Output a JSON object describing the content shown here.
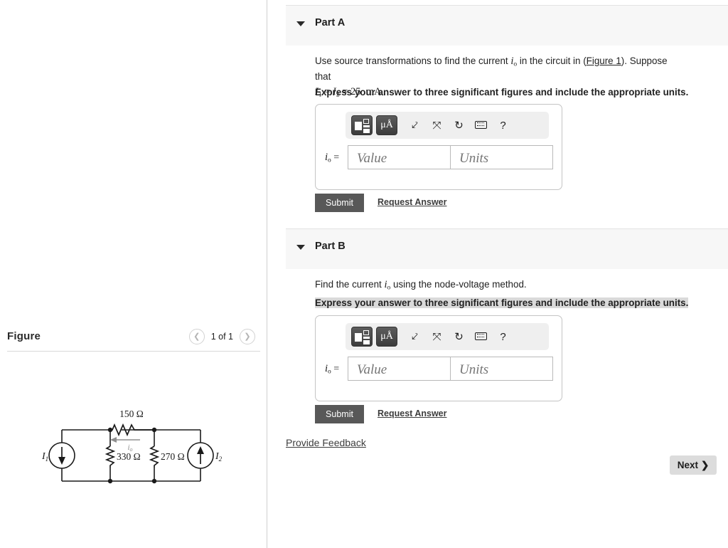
{
  "figure_panel": {
    "title": "Figure",
    "pager": {
      "prev_icon": "chevron-left-icon",
      "next_icon": "chevron-right-icon",
      "count_label": "1 of 1"
    },
    "circuit": {
      "source_left_label": "I",
      "source_left_sub": "1",
      "source_left_direction": "down",
      "source_right_label": "I",
      "source_right_sub": "2",
      "source_right_direction": "up",
      "top_resistor": "150 Ω",
      "left_resistor": "330 Ω",
      "right_resistor": "270 Ω",
      "current_label": "i",
      "current_sub": "o",
      "current_direction": "left"
    }
  },
  "parts": [
    {
      "id": "part-a",
      "caret_icon": "caret-down-icon",
      "title": "Part A",
      "prompt_pre": "Use source transformations to find the current ",
      "prompt_sym": "i",
      "prompt_sym_sub": "o",
      "prompt_mid": " in the circuit in (",
      "prompt_link": "Figure 1",
      "prompt_post": "). Suppose that",
      "prompt_line2": "I₁ = I₂ = 25 mA .",
      "instruction": "Express your answer to three significant figures and include the appropriate units.",
      "instruction_highlighted": false,
      "answer": {
        "label_sym": "i",
        "label_sub": "o",
        "label_eq": " = ",
        "value_placeholder": "Value",
        "value": "",
        "units_placeholder": "Units",
        "units": "",
        "toolbar": [
          {
            "name": "math-template-button",
            "label": ""
          },
          {
            "name": "units-button",
            "label": "μÅ"
          },
          {
            "name": "undo-icon",
            "label": "⮤"
          },
          {
            "name": "redo-icon",
            "label": "⮥"
          },
          {
            "name": "reset-icon",
            "label": "↺"
          },
          {
            "name": "keyboard-icon",
            "label": ""
          },
          {
            "name": "help-icon",
            "label": "?"
          }
        ]
      },
      "submit_label": "Submit",
      "request_answer_label": "Request Answer"
    },
    {
      "id": "part-b",
      "caret_icon": "caret-down-icon",
      "title": "Part B",
      "prompt_pre": "Find the current ",
      "prompt_sym": "i",
      "prompt_sym_sub": "o",
      "prompt_mid": " using the node-voltage method.",
      "prompt_link": "",
      "prompt_post": "",
      "prompt_line2": "",
      "instruction": "Express your answer to three significant figures and include the appropriate units.",
      "instruction_highlighted": true,
      "answer": {
        "label_sym": "i",
        "label_sub": "o",
        "label_eq": " = ",
        "value_placeholder": "Value",
        "value": "",
        "units_placeholder": "Units",
        "units": "",
        "toolbar": [
          {
            "name": "math-template-button",
            "label": ""
          },
          {
            "name": "units-button",
            "label": "μÅ"
          },
          {
            "name": "undo-icon",
            "label": "⮤"
          },
          {
            "name": "redo-icon",
            "label": "⮥"
          },
          {
            "name": "reset-icon",
            "label": "↺"
          },
          {
            "name": "keyboard-icon",
            "label": ""
          },
          {
            "name": "help-icon",
            "label": "?"
          }
        ]
      },
      "submit_label": "Submit",
      "request_answer_label": "Request Answer"
    }
  ],
  "footer": {
    "provide_feedback_label": "Provide Feedback",
    "next_label": "Next",
    "next_icon": "chevron-right-icon"
  },
  "colors": {
    "submit_bg": "#585858",
    "next_bg": "#dcdcdc",
    "part_header_bg": "#f7f7f7",
    "highlight": "#dadada"
  }
}
